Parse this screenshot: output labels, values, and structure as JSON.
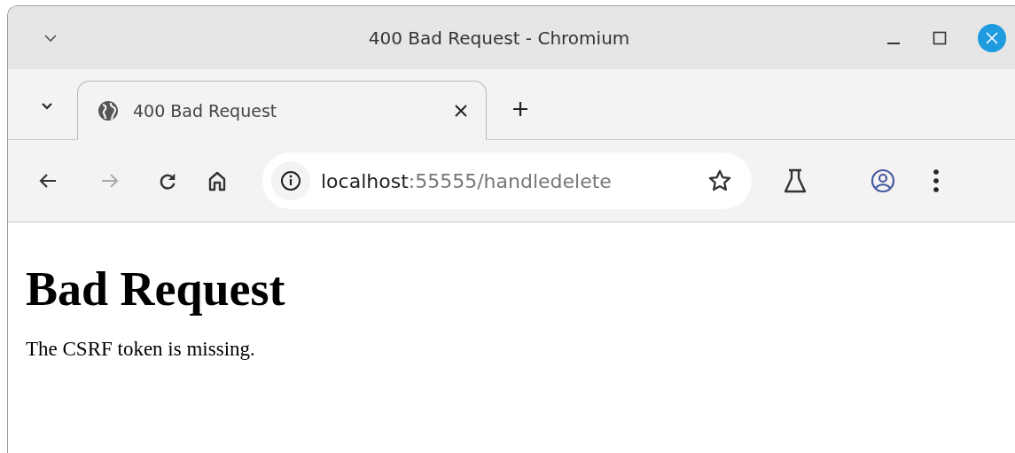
{
  "window": {
    "title": "400 Bad Request - Chromium"
  },
  "tabs": [
    {
      "label": "400 Bad Request",
      "selected": true
    }
  ],
  "toolbar": {
    "forward_disabled": true,
    "address": {
      "host": "localhost",
      "path": ":55555/handledelete"
    }
  },
  "page": {
    "heading": "Bad Request",
    "message": "The CSRF token is missing."
  }
}
